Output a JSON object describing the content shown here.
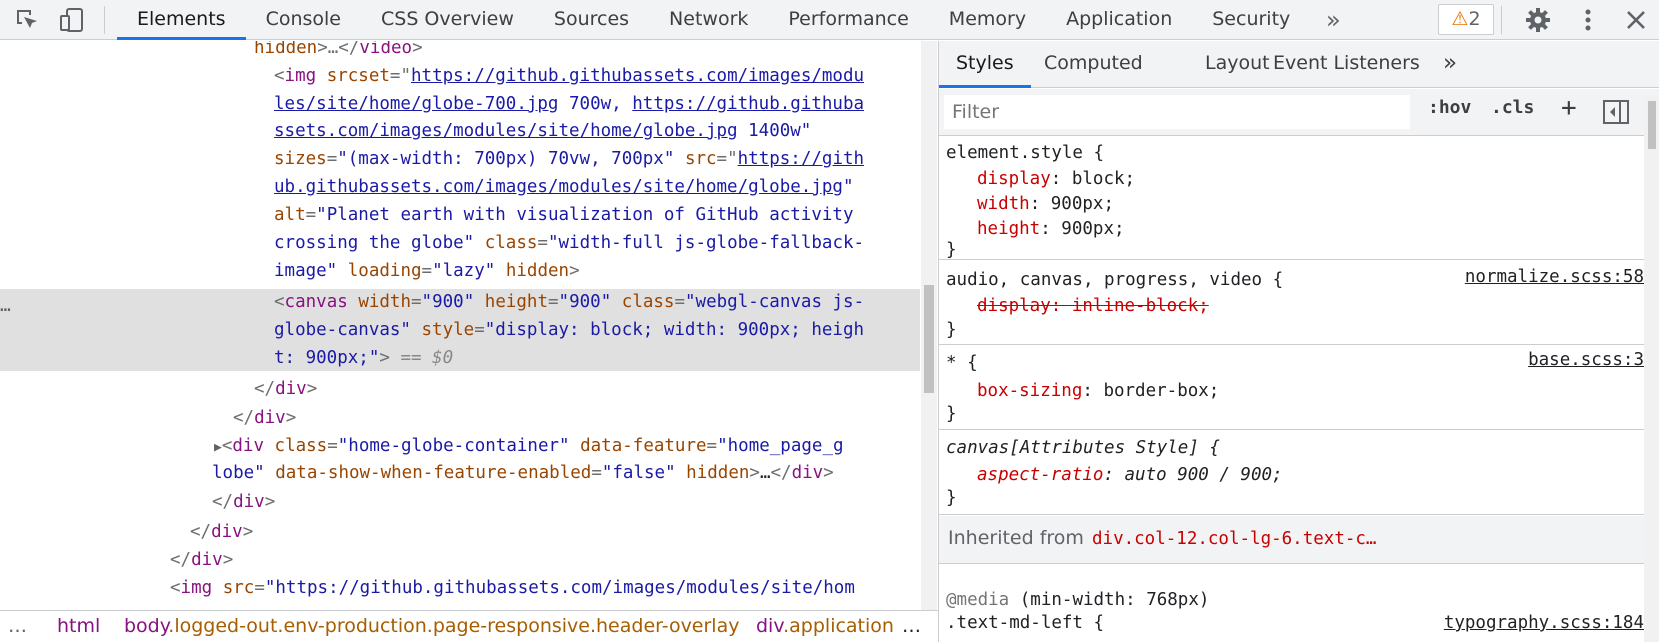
{
  "toolbar": {
    "tabs": [
      "Elements",
      "Console",
      "CSS Overview",
      "Sources",
      "Network",
      "Performance",
      "Memory",
      "Application",
      "Security"
    ],
    "more": "»",
    "warnings": "2"
  },
  "elements": {
    "l0": {
      "a": "hidden",
      "b": ">…</",
      "c": "video",
      "d": ">"
    },
    "img": {
      "open": "<",
      "tag": "img",
      "srcset_attr": "srcset",
      "q": "=\"",
      "url1a": "https://github.githubassets.com/images/modu",
      "url1b": "les/site/home/globe-700.jpg",
      "w1": " 700w, ",
      "url2a": "https://github.githuba",
      "url2b": "ssets.com/images/modules/site/home/globe.jpg",
      "w2": " 1400w\"",
      "sizes_attr": "sizes",
      "sizes_val": "\"(max-width: 700px) 70vw, 700px\"",
      "src_attr": "src",
      "src_a": "https://gith",
      "src_b": "ub.githubassets.com/images/modules/site/home/globe.jpg",
      "alt_attr": "alt",
      "alt_a": "\"Planet earth with visualization of GitHub activity",
      "alt_b": "crossing the globe\"",
      "class_attr": "class",
      "class_a": "\"width-full js-globe-fallback-",
      "class_b": "image\"",
      "loading_attr": "loading",
      "loading_val": "\"lazy\"",
      "hidden": "hidden",
      "close": ">"
    },
    "canvas": {
      "tag": "canvas",
      "width_attr": "width",
      "width_val": "\"900\"",
      "height_attr": "height",
      "height_val": "\"900\"",
      "class_attr": "class",
      "class_a": "\"webgl-canvas js-",
      "class_b": "globe-canvas\"",
      "style_attr": "style",
      "style_a": "\"display: block; width: 900px; heigh",
      "style_b": "t: 900px;\"",
      "marker": "== $0",
      "dots": "…"
    },
    "div_close": "div",
    "globe_container": {
      "tag": "div",
      "class_attr": "class",
      "class_val": "\"home-globe-container\"",
      "feat_attr": "data-feature",
      "feat_a": "\"home_page_g",
      "feat_b": "lobe\"",
      "show_attr": "data-show-when-feature-enabled",
      "show_val": "\"false\"",
      "hidden": "hidden",
      "ellipsis": "…"
    },
    "last": {
      "tag": "img",
      "attr": "src",
      "val": "\"https://github.githubassets.com/images/modules/site/hom"
    }
  },
  "breadcrumbs": {
    "dots": "…",
    "items": [
      {
        "tag": "html",
        "cls": ""
      },
      {
        "tag": "body",
        "cls": ".logged-out.env-production.page-responsive.header-overlay"
      },
      {
        "tag": "div",
        "cls": ".application"
      }
    ],
    "more": "…"
  },
  "styles": {
    "tabs": [
      "Styles",
      "Computed",
      "Layout",
      "Event Listeners"
    ],
    "more": "»",
    "filter_placeholder": "Filter",
    "hov": ":hov",
    "cls": ".cls",
    "plus": "+",
    "rules": {
      "element_style": {
        "selector": "element.style {",
        "p1": "display",
        "v1": "block;",
        "p2": "width",
        "v2": "900px;",
        "p3": "height",
        "v3": "900px;",
        "close": "}"
      },
      "normalize": {
        "selector": "audio, canvas, progress, video {",
        "source": "normalize.scss:58",
        "struck": "display: inline-block;",
        "close": "}"
      },
      "base": {
        "selector": "* {",
        "source": "base.scss:3",
        "p1": "box-sizing",
        "v1": "border-box;",
        "close": "}"
      },
      "attr_style": {
        "selector": "canvas[Attributes Style] {",
        "p1": "aspect-ratio",
        "v1": "auto 900 / 900;",
        "close": "}"
      }
    },
    "inherited_label": "Inherited from",
    "inherited_from": "div.col-12.col-lg-6.text-c…",
    "media": {
      "at": "@media",
      "query": "(min-width: 768px)"
    },
    "md_rule": {
      "selector": ".text-md-left {",
      "source": "typography.scss:184"
    }
  }
}
